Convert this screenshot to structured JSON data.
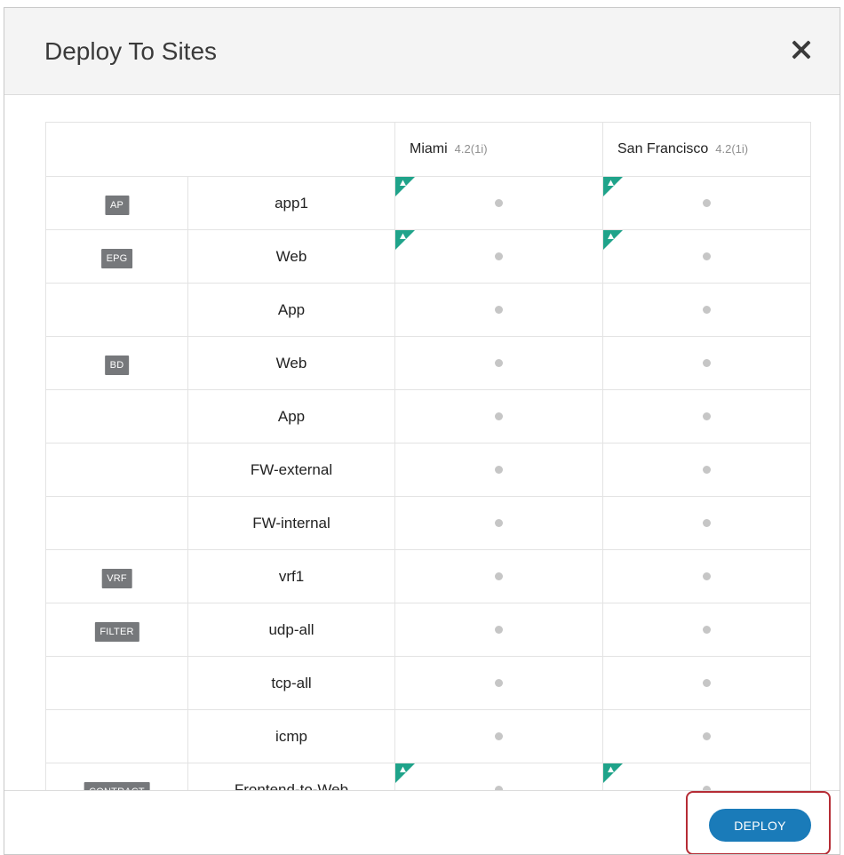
{
  "modal": {
    "title": "Deploy To Sites",
    "close_icon": "close-icon"
  },
  "sites": [
    {
      "name": "Miami",
      "version": "4.2(1i)"
    },
    {
      "name": "San Francisco",
      "version": "4.2(1i)"
    }
  ],
  "rows": [
    {
      "type": "AP",
      "name": "app1",
      "flags": [
        true,
        true
      ]
    },
    {
      "type": "EPG",
      "name": "Web",
      "flags": [
        true,
        true
      ]
    },
    {
      "type": "",
      "name": "App",
      "flags": [
        false,
        false
      ]
    },
    {
      "type": "BD",
      "name": "Web",
      "flags": [
        false,
        false
      ]
    },
    {
      "type": "",
      "name": "App",
      "flags": [
        false,
        false
      ]
    },
    {
      "type": "",
      "name": "FW-external",
      "flags": [
        false,
        false
      ]
    },
    {
      "type": "",
      "name": "FW-internal",
      "flags": [
        false,
        false
      ]
    },
    {
      "type": "VRF",
      "name": "vrf1",
      "flags": [
        false,
        false
      ]
    },
    {
      "type": "FILTER",
      "name": "udp-all",
      "flags": [
        false,
        false
      ]
    },
    {
      "type": "",
      "name": "tcp-all",
      "flags": [
        false,
        false
      ]
    },
    {
      "type": "",
      "name": "icmp",
      "flags": [
        false,
        false
      ]
    },
    {
      "type": "CONTRACT",
      "name": "Frontend-to-Web",
      "flags": [
        true,
        true
      ]
    }
  ],
  "footer": {
    "deploy_label": "DEPLOY"
  },
  "colors": {
    "flag": "#1fa38a",
    "deploy_button": "#1a7bb9",
    "highlight": "#b52c35",
    "badge": "#76787b",
    "status_dot": "#c6c6c6"
  }
}
